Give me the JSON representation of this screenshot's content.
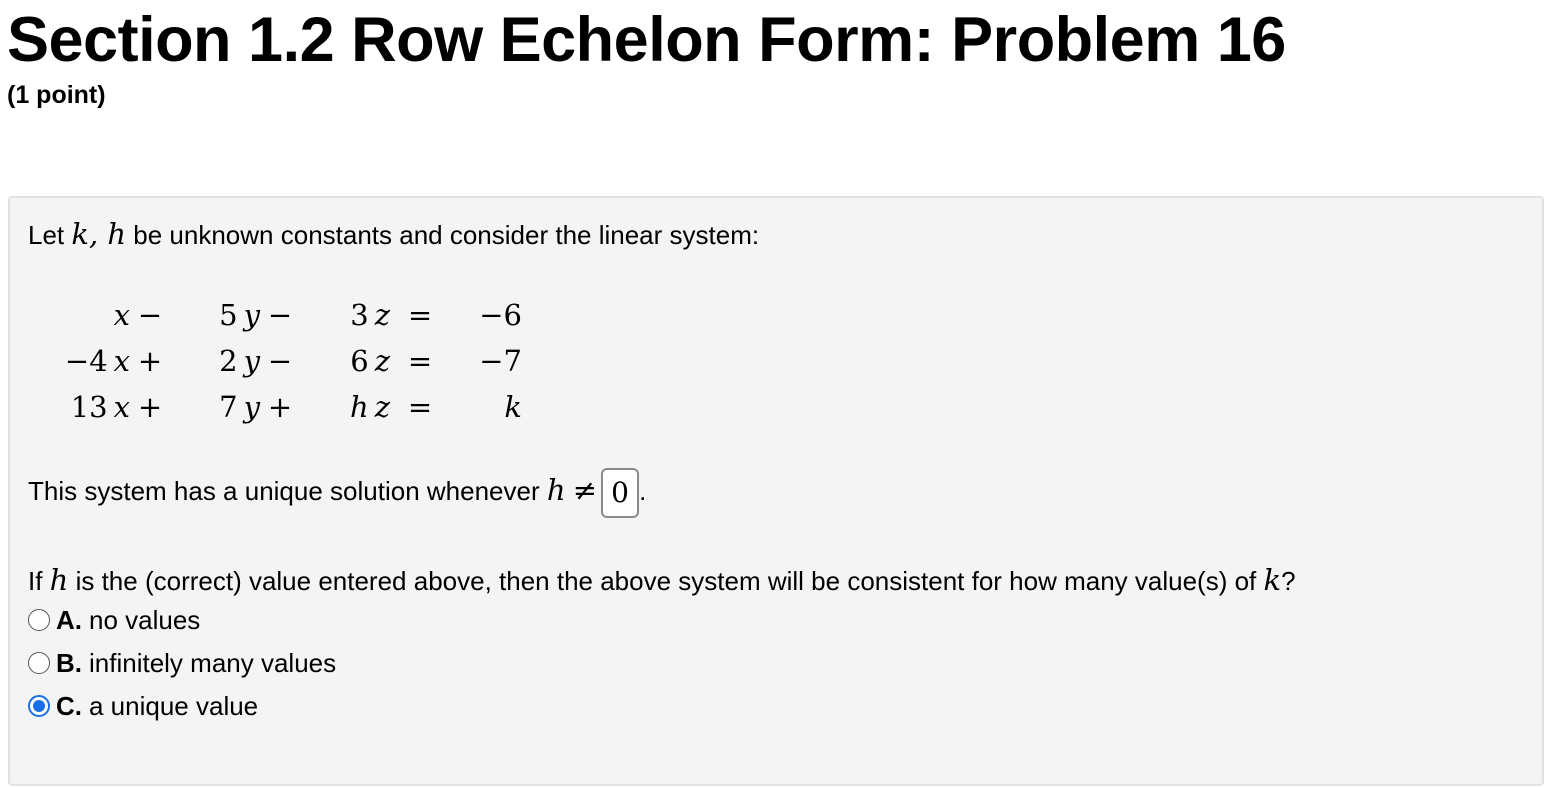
{
  "header": {
    "title": "Section 1.2 Row Echelon Form: Problem 16",
    "points": "(1 point)"
  },
  "problem": {
    "intro_prefix": "Let ",
    "intro_vars": "k, h",
    "intro_suffix": " be unknown constants and consider the linear system:",
    "system": [
      {
        "t1_coef": "",
        "t1_var": "x",
        "op1": "−",
        "t2_coef": "5",
        "t2_var": "y",
        "op2": "−",
        "t3_coef": "3",
        "t3_var": "z",
        "eq": "=",
        "rhs": "−6",
        "rhs_italic": false
      },
      {
        "t1_coef": "−4",
        "t1_var": "x",
        "op1": "+",
        "t2_coef": "2",
        "t2_var": "y",
        "op2": "−",
        "t3_coef": "6",
        "t3_var": "z",
        "eq": "=",
        "rhs": "−7",
        "rhs_italic": false
      },
      {
        "t1_coef": "13",
        "t1_var": "x",
        "op1": "+",
        "t2_coef": "7",
        "t2_var": "y",
        "op2": "+",
        "t3_coef": "h",
        "t3_var": "z",
        "eq": "=",
        "rhs": "k",
        "rhs_italic": true
      }
    ],
    "unique_prefix": "This system has a unique solution whenever ",
    "unique_var": "h",
    "unique_neq": "≠",
    "answer_value": "0",
    "unique_suffix": ".",
    "question_prefix": "If ",
    "question_var_h": "h",
    "question_mid": " is the (correct) value entered above, then the above system will be consistent for how many value(s) of ",
    "question_var_k": "k",
    "question_suffix": "?",
    "choices": [
      {
        "letter": "A.",
        "label": "no values",
        "selected": false
      },
      {
        "letter": "B.",
        "label": "infinitely many values",
        "selected": false
      },
      {
        "letter": "C.",
        "label": "a unique value",
        "selected": true
      }
    ],
    "accent_color": "#1a6ee8"
  }
}
